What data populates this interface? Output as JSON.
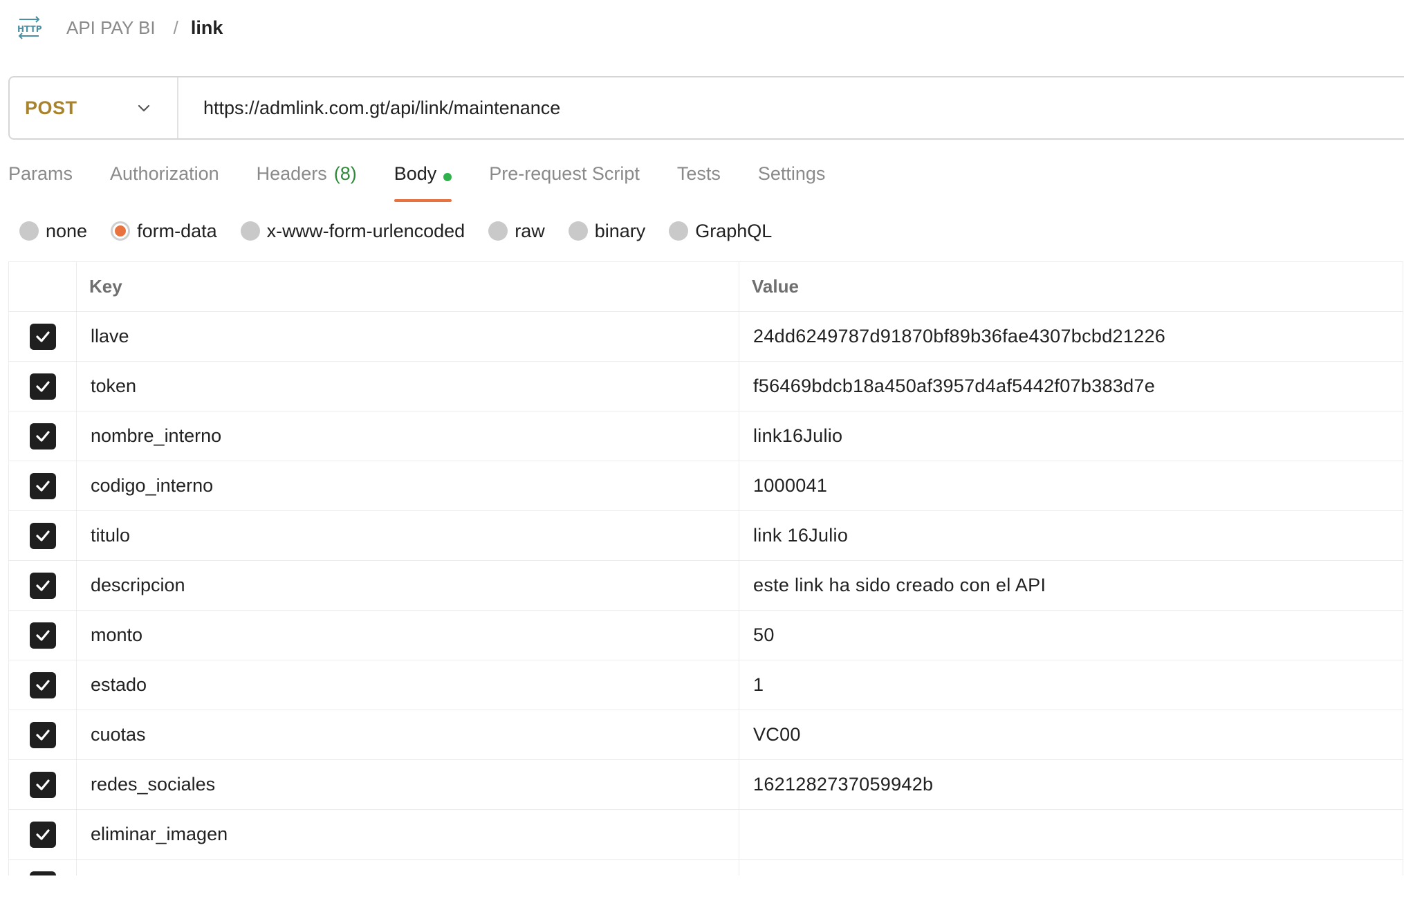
{
  "breadcrumb": {
    "icon": "http-icon",
    "collection": "API PAY BI",
    "separator": "/",
    "current": "link"
  },
  "request": {
    "method": "POST",
    "url": "https://admlink.com.gt/api/link/maintenance"
  },
  "tabs": [
    {
      "label": "Params",
      "active": false
    },
    {
      "label": "Authorization",
      "active": false
    },
    {
      "label": "Headers",
      "count": "(8)",
      "active": false
    },
    {
      "label": "Body",
      "active": true,
      "indicator": "green-dot"
    },
    {
      "label": "Pre-request Script",
      "active": false
    },
    {
      "label": "Tests",
      "active": false
    },
    {
      "label": "Settings",
      "active": false
    }
  ],
  "body_types": [
    {
      "label": "none",
      "selected": false
    },
    {
      "label": "form-data",
      "selected": true
    },
    {
      "label": "x-www-form-urlencoded",
      "selected": false
    },
    {
      "label": "raw",
      "selected": false
    },
    {
      "label": "binary",
      "selected": false
    },
    {
      "label": "GraphQL",
      "selected": false
    }
  ],
  "table": {
    "headers": {
      "key": "Key",
      "value": "Value"
    },
    "rows": [
      {
        "checked": true,
        "key": "llave",
        "value": "24dd6249787d91870bf89b36fae4307bcbd21226"
      },
      {
        "checked": true,
        "key": "token",
        "value": "f56469bdcb18a450af3957d4af5442f07b383d7e"
      },
      {
        "checked": true,
        "key": "nombre_interno",
        "value": "link16Julio"
      },
      {
        "checked": true,
        "key": "codigo_interno",
        "value": "1000041"
      },
      {
        "checked": true,
        "key": "titulo",
        "value": "link 16Julio"
      },
      {
        "checked": true,
        "key": "descripcion",
        "value": "este link ha sido creado con el API"
      },
      {
        "checked": true,
        "key": "monto",
        "value": "50"
      },
      {
        "checked": true,
        "key": "estado",
        "value": "1"
      },
      {
        "checked": true,
        "key": "cuotas",
        "value": "VC00"
      },
      {
        "checked": true,
        "key": "redes_sociales",
        "value": "1621282737059942b"
      },
      {
        "checked": true,
        "key": "eliminar_imagen",
        "value": ""
      }
    ]
  },
  "colors": {
    "method": "#a8832d",
    "accent": "#e8733f",
    "body_dot": "#2fb24c",
    "headers_count": "#2f8a3a",
    "checkbox": "#1f1f1f"
  }
}
